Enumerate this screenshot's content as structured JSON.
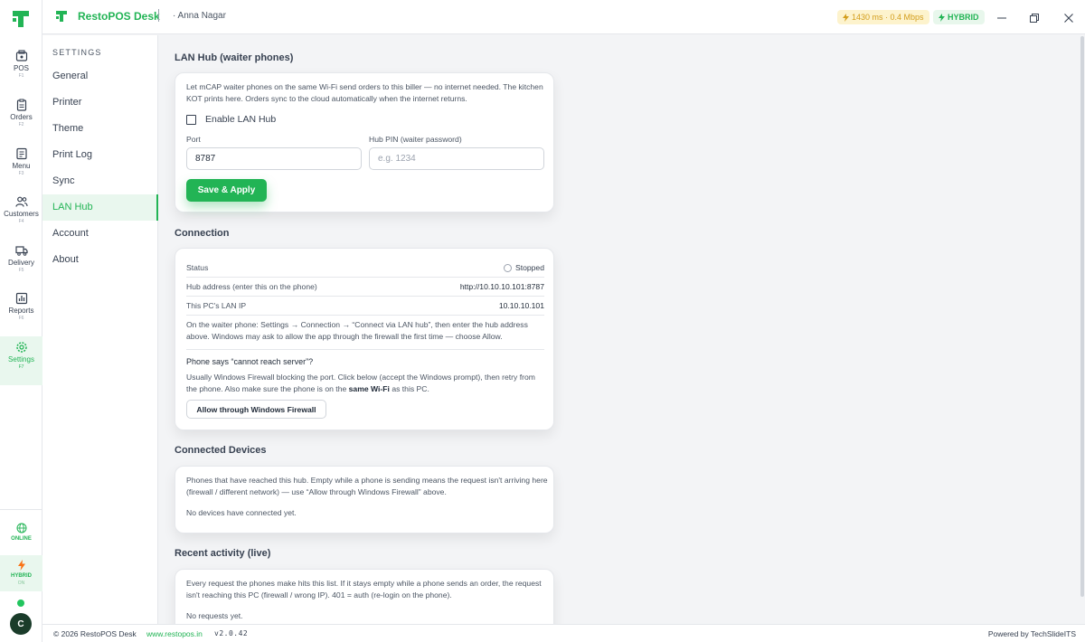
{
  "titlebar": {
    "app_name": "RestoPOS Desk",
    "branch": "· Anna Nagar",
    "network": "1430 ms · 0.4 Mbps",
    "mode": "HYBRID"
  },
  "rail": {
    "items": [
      {
        "label": "POS",
        "key": "F1",
        "icon": "pos-icon"
      },
      {
        "label": "Orders",
        "key": "F2",
        "icon": "clipboard-icon"
      },
      {
        "label": "Menu",
        "key": "F3",
        "icon": "menu-doc-icon"
      },
      {
        "label": "Customers",
        "key": "F4",
        "icon": "users-icon"
      },
      {
        "label": "Delivery",
        "key": "F5",
        "icon": "truck-icon"
      },
      {
        "label": "Reports",
        "key": "F6",
        "icon": "bar-chart-icon"
      },
      {
        "label": "Settings",
        "key": "F7",
        "icon": "gear-icon"
      }
    ],
    "online_label": "ONLINE",
    "hybrid_label": "HYBRID",
    "hybrid_state": "ON",
    "avatar_initial": "C"
  },
  "settings_nav": {
    "heading": "SETTINGS",
    "items": [
      "General",
      "Printer",
      "Theme",
      "Print Log",
      "Sync",
      "LAN Hub",
      "Account",
      "About"
    ],
    "active": "LAN Hub"
  },
  "lan_hub": {
    "title": "LAN Hub (waiter phones)",
    "description": "Let mCAP waiter phones on the same Wi-Fi send orders to this biller — no internet needed. The kitchen KOT prints here. Orders sync to the cloud automatically when the internet returns.",
    "enable_label": "Enable LAN Hub",
    "port_label": "Port",
    "port_value": "8787",
    "pin_label": "Hub PIN (waiter password)",
    "pin_placeholder": "e.g. 1234",
    "save_label": "Save & Apply"
  },
  "connection": {
    "title": "Connection",
    "rows": [
      {
        "key": "Status",
        "value": "Stopped"
      },
      {
        "key": "Hub address (enter this on the phone)",
        "value": "http://10.10.10.101:8787"
      },
      {
        "key": "This PC's LAN IP",
        "value": "10.10.10.101"
      }
    ],
    "instructions": "On the waiter phone: Settings → Connection → “Connect via LAN hub”, then enter the hub address above. Windows may ask to allow the app through the firewall the first time — choose Allow.",
    "help_title": "Phone says “cannot reach server”?",
    "help_text_before": "Usually Windows Firewall blocking the port. Click below (accept the Windows prompt), then retry from the phone. Also make sure the phone is on the ",
    "help_text_bold": "same Wi-Fi",
    "help_text_after": " as this PC.",
    "firewall_button": "Allow through Windows Firewall"
  },
  "devices": {
    "title": "Connected Devices",
    "description": "Phones that have reached this hub. Empty while a phone is sending means the request isn't arriving here (firewall / different network) — use “Allow through Windows Firewall” above.",
    "empty": "No devices have connected yet."
  },
  "activity": {
    "title": "Recent activity (live)",
    "description": "Every request the phones make hits this list. If it stays empty while a phone sends an order, the request isn't reaching this PC (firewall / wrong IP). 401 = auth (re-login on the phone).",
    "empty": "No requests yet."
  },
  "footer": {
    "copyright": "© 2026 RestoPOS Desk",
    "website": "www.restopos.in",
    "version": "v2.0.42",
    "powered": "Powered by TechSlideITS"
  },
  "colors": {
    "accent": "#22b455",
    "accent_bg": "#e9f7ee",
    "warning_bg": "#fdf3cd",
    "warning_text": "#d39e1c"
  }
}
